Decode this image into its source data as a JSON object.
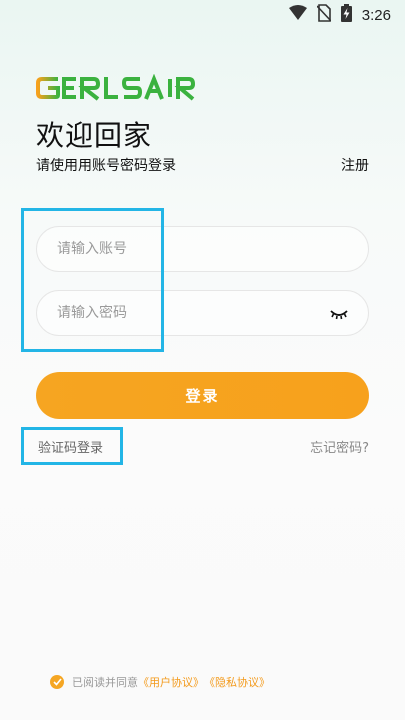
{
  "status_bar": {
    "time": "3:26",
    "icons": [
      "wifi-icon",
      "no-sim-icon",
      "battery-charging-icon"
    ]
  },
  "logo": {
    "text": "GERLSAIR"
  },
  "header": {
    "title": "欢迎回家",
    "subtitle": "请使用用账号密码登录",
    "register_label": "注册"
  },
  "form": {
    "account_placeholder": "请输入账号",
    "account_value": "",
    "password_placeholder": "请输入密码",
    "password_value": "",
    "password_toggle_icon": "eye-closed-icon"
  },
  "actions": {
    "login_label": "登录",
    "code_login_label": "验证码登录",
    "forgot_label": "忘记密码?"
  },
  "agreement": {
    "prefix": "已阅读并同意",
    "user_agreement": "《用户协议》",
    "privacy_policy": "《隐私协议》",
    "checked": true
  },
  "colors": {
    "accent": "#F7A11C",
    "highlight": "#23B5E6",
    "logo_green": "#3BB23F"
  }
}
